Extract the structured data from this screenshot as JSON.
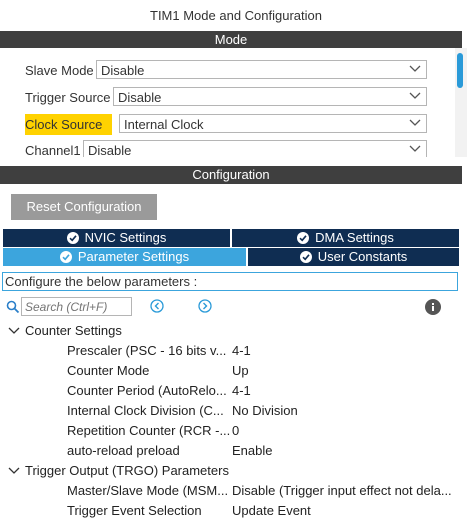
{
  "window": {
    "title": "TIM1 Mode and Configuration"
  },
  "mode": {
    "header": "Mode",
    "rows": [
      {
        "label": "Slave Mode",
        "value": "Disable"
      },
      {
        "label": "Trigger Source",
        "value": "Disable"
      },
      {
        "label": "Clock Source",
        "value": "Internal Clock"
      },
      {
        "label": "Channel1",
        "value": "Disable"
      }
    ]
  },
  "configuration": {
    "header": "Configuration",
    "reset_label": "Reset Configuration",
    "tabs": {
      "nvic": "NVIC Settings",
      "dma": "DMA Settings",
      "parameter": "Parameter Settings",
      "user_constants": "User Constants"
    },
    "hint": "Configure the below parameters :",
    "search_placeholder": "Search (Ctrl+F)",
    "categories": [
      {
        "name": "Counter Settings",
        "params": [
          {
            "name": "Prescaler (PSC - 16 bits v...",
            "value": "4-1"
          },
          {
            "name": "Counter Mode",
            "value": "Up"
          },
          {
            "name": "Counter Period (AutoRelo...",
            "value": "4-1"
          },
          {
            "name": "Internal Clock Division (C...",
            "value": "No Division"
          },
          {
            "name": "Repetition Counter (RCR -...",
            "value": "0"
          },
          {
            "name": "auto-reload preload",
            "value": "Enable"
          }
        ]
      },
      {
        "name": "Trigger Output (TRGO) Parameters",
        "params": [
          {
            "name": "Master/Slave Mode (MSM...",
            "value": "Disable (Trigger input effect not dela..."
          },
          {
            "name": "Trigger Event Selection",
            "value": "Update Event"
          }
        ]
      }
    ]
  },
  "colors": {
    "header_bar": "#3f3f3f",
    "tab_dark": "#0f2d52",
    "tab_active": "#3ca5dd",
    "highlight": "#ffd200",
    "scroll_thumb": "#2a9ad8"
  }
}
